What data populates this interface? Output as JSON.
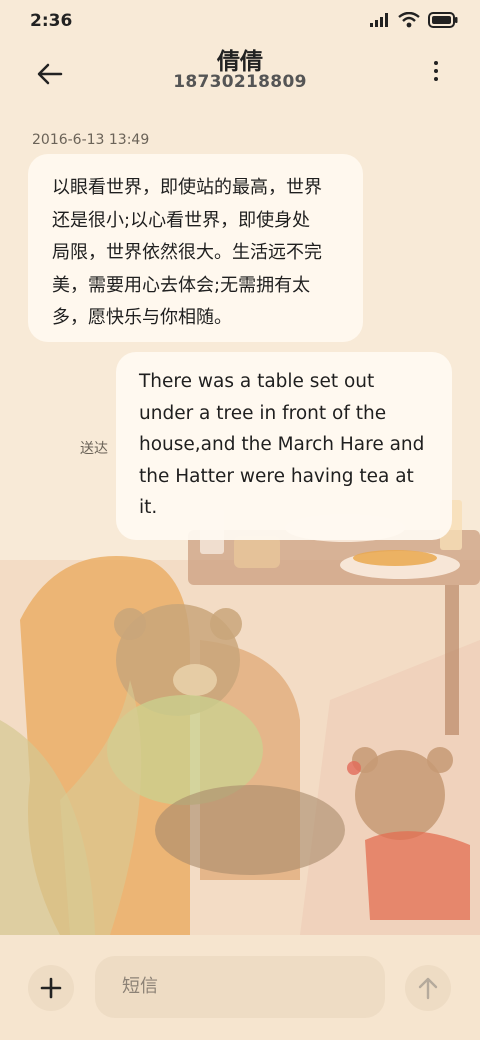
{
  "status": {
    "time": "2:36"
  },
  "header": {
    "name": "倩倩",
    "number": "18730218809"
  },
  "conversation": {
    "timestamp": "2016-6-13 13:49",
    "incoming": [
      "以眼看世界，即使站的最高，世界",
      "还是很小;以心看世界，即使身处",
      "局限，世界依然很大。生活远不完",
      "美，需要用心去体会;无需拥有太",
      "多，愿快乐与你相随。"
    ],
    "outgoing": [
      "There was a table set out",
      "under a tree in front of the",
      "house,and the March Hare and",
      "the Hatter were having tea at",
      "it."
    ],
    "delivered_label": "送达"
  },
  "composer": {
    "placeholder": "短信"
  },
  "icons": {
    "back": "arrow-left-icon",
    "menu": "more-vertical-icon",
    "add": "plus-icon",
    "send": "arrow-up-icon",
    "signal": "signal-icon",
    "wifi": "wifi-icon",
    "battery": "battery-icon"
  },
  "colors": {
    "background": "#f7e8d3",
    "bubble": "#fff8ee",
    "composer": "#eedcc4"
  }
}
